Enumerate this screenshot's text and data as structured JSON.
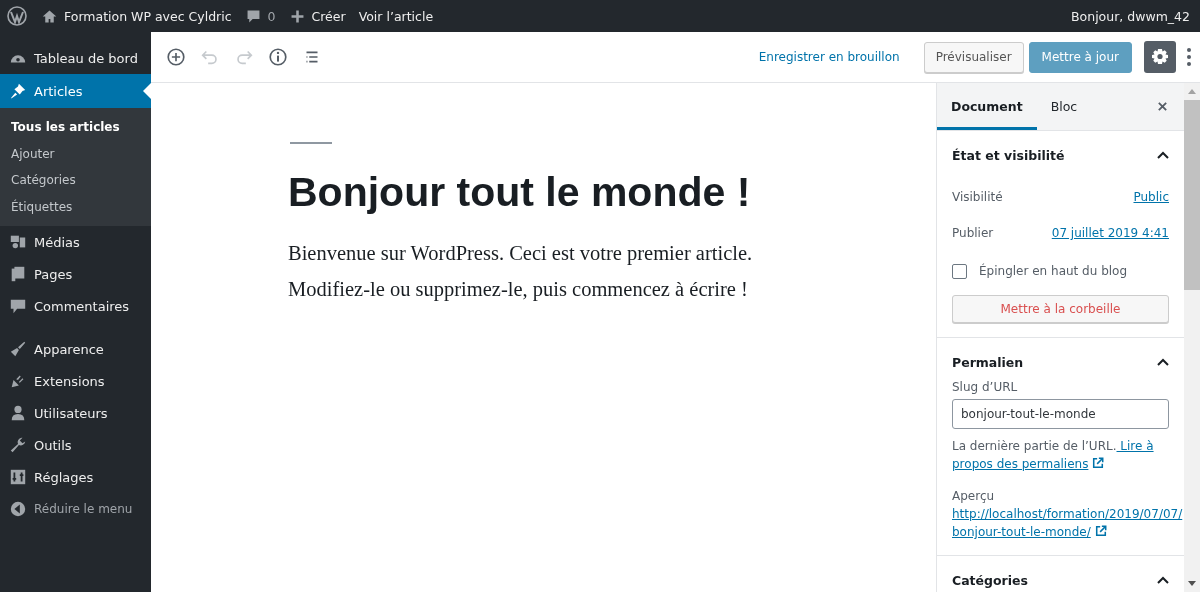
{
  "admin_bar": {
    "site_title": "Formation WP avec Cyldric",
    "comments_count": "0",
    "new_label": "Créer",
    "view_label": "Voir l’article",
    "greeting": "Bonjour, dwwm_42"
  },
  "sidebar": {
    "items": [
      {
        "label": "Tableau de bord",
        "selected": false
      },
      {
        "label": "Articles",
        "selected": true,
        "children": [
          {
            "label": "Tous les articles",
            "selected": true
          },
          {
            "label": "Ajouter",
            "selected": false
          },
          {
            "label": "Catégories",
            "selected": false
          },
          {
            "label": "Étiquettes",
            "selected": false
          }
        ]
      },
      {
        "label": "Médias",
        "selected": false
      },
      {
        "label": "Pages",
        "selected": false
      },
      {
        "label": "Commentaires",
        "selected": false
      },
      {
        "label": "Apparence",
        "selected": false
      },
      {
        "label": "Extensions",
        "selected": false
      },
      {
        "label": "Utilisateurs",
        "selected": false
      },
      {
        "label": "Outils",
        "selected": false
      },
      {
        "label": "Réglages",
        "selected": false
      }
    ],
    "collapse_label": "Réduire le menu"
  },
  "toolbar": {
    "undo_disabled": true,
    "redo_disabled": true,
    "save_draft": "Enregistrer en brouillon",
    "preview": "Prévisualiser",
    "update": {
      "label": "Mettre à jour",
      "disabled": true
    },
    "settings_on": true
  },
  "post": {
    "title": "Bonjour tout le monde !",
    "paragraph": "Bienvenue sur WordPress. Ceci est votre premier article. Modifiez-le ou supprimez-le, puis commencez à écrire !"
  },
  "settings": {
    "tabs": [
      {
        "label": "Document",
        "selected": true
      },
      {
        "label": "Bloc",
        "selected": false
      }
    ],
    "status": {
      "title": "État et visibilité",
      "expanded": true,
      "visibility_label": "Visibilité",
      "visibility_value": "Public",
      "publish_label": "Publier",
      "publish_value": "07 juillet 2019 4:41",
      "sticky_label": "Épingler en haut du blog",
      "sticky_checked": false,
      "trash": "Mettre à la corbeille"
    },
    "permalink": {
      "title": "Permalien",
      "expanded": true,
      "slug_label": "Slug d’URL",
      "slug_value": "bonjour-tout-le-monde",
      "help": "La dernière partie de l’URL.",
      "help_link": " Lire à",
      "help_link_2": "propos des permaliens",
      "preview_label": "Aperçu",
      "preview_url": "http://localhost/formation/2019/07/07/",
      "preview_url_2": "bonjour-tout-le-monde/"
    },
    "categories": {
      "title": "Catégories",
      "expanded": true
    }
  }
}
